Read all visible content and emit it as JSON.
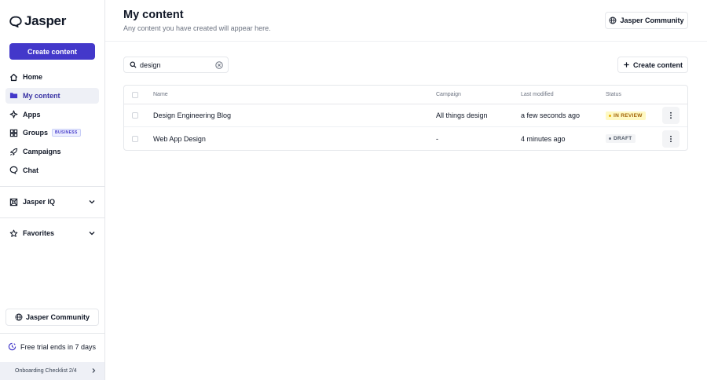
{
  "app": {
    "brand": "Jasper"
  },
  "sidebar": {
    "create_label": "Create content",
    "items": [
      {
        "label": "Home",
        "icon": "home-icon"
      },
      {
        "label": "My content",
        "icon": "folder-icon",
        "active": true
      },
      {
        "label": "Apps",
        "icon": "apps-icon"
      },
      {
        "label": "Groups",
        "icon": "groups-icon",
        "badge": "BUSINESS"
      },
      {
        "label": "Campaigns",
        "icon": "rocket-icon"
      },
      {
        "label": "Chat",
        "icon": "chat-icon"
      }
    ],
    "jasper_iq": "Jasper IQ",
    "favorites": "Favorites",
    "community": "Jasper Community",
    "trial": "Free trial ends in 7 days",
    "onboarding": "Onboarding Checklist 2/4"
  },
  "header": {
    "title": "My content",
    "subtitle": "Any content you have created will appear here.",
    "community": "Jasper Community"
  },
  "toolbar": {
    "search_value": "design",
    "create_label": "Create content"
  },
  "table": {
    "columns": {
      "name": "Name",
      "campaign": "Campaign",
      "modified": "Last modified",
      "status": "Status"
    },
    "rows": [
      {
        "name": "Design Engineering Blog",
        "campaign": "All things design",
        "modified": "a few seconds ago",
        "status": "IN REVIEW"
      },
      {
        "name": "Web App Design",
        "campaign": "-",
        "modified": "4 minutes ago",
        "status": "DRAFT"
      }
    ]
  },
  "colors": {
    "primary": "#4338ca",
    "review_bg": "#fef9c3",
    "review_text": "#a16207",
    "review_dot": "#eab308",
    "draft_bg": "#f3f4f6",
    "draft_dot": "#6b7280"
  }
}
